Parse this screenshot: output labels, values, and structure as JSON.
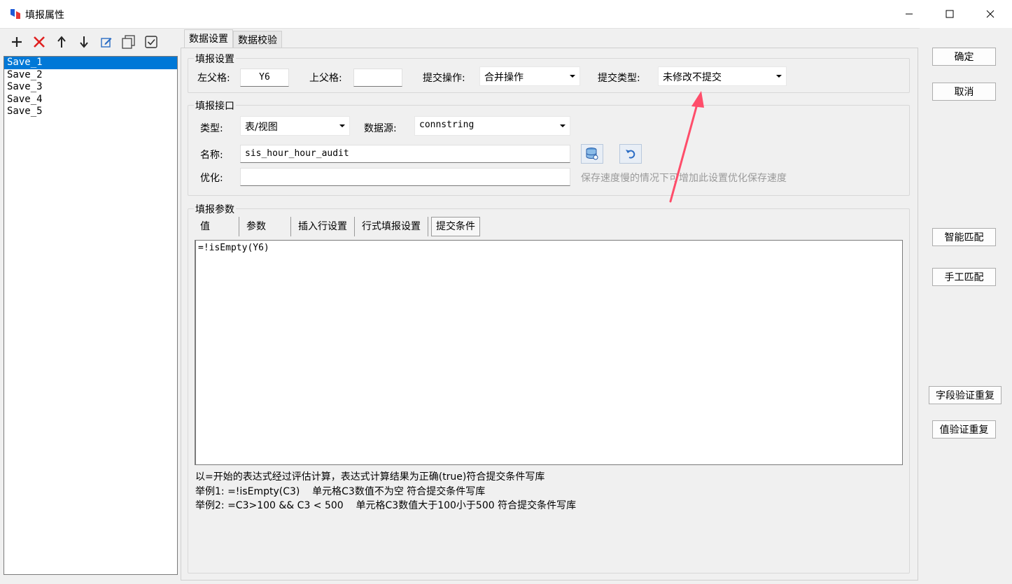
{
  "window": {
    "title": "填报属性",
    "minimize_icon": "minimize-icon",
    "maximize_icon": "maximize-icon",
    "close_icon": "close-icon"
  },
  "left_toolbar": {
    "icons": [
      "plus-icon",
      "delete-x-icon",
      "arrow-up-icon",
      "arrow-down-icon",
      "edit-icon",
      "copy-icon",
      "check-icon"
    ]
  },
  "save_list": {
    "items": [
      "Save_1",
      "Save_2",
      "Save_3",
      "Save_4",
      "Save_5"
    ],
    "selected": "Save_1"
  },
  "tabs": [
    "数据设置",
    "数据校验"
  ],
  "fill_settings": {
    "title": "填报设置",
    "left_parent_label": "左父格:",
    "left_parent_value": "Y6",
    "top_parent_label": "上父格:",
    "top_parent_value": "",
    "submit_op_label": "提交操作:",
    "submit_op_value": "合并操作",
    "submit_type_label": "提交类型:",
    "submit_type_value": "未修改不提交"
  },
  "fill_interface": {
    "title": "填报接口",
    "type_label": "类型:",
    "type_value": "表/视图",
    "datasource_label": "数据源:",
    "datasource_value": "connstring",
    "name_label": "名称:",
    "name_value": "sis_hour_hour_audit",
    "optimize_label": "优化:",
    "optimize_value": "",
    "optimize_hint": "保存速度慢的情况下可增加此设置优化保存速度"
  },
  "fill_params": {
    "title": "填报参数",
    "subtabs": [
      "值",
      "参数",
      "插入行设置",
      "行式填报设置",
      "提交条件"
    ],
    "active_subtab": "提交条件",
    "expression": "=!isEmpty(Y6)",
    "help": [
      "以=开始的表达式经过评估计算，表达式计算结果为正确(true)符合提交条件写库",
      "举例1: =!isEmpty(C3)    单元格C3数值不为空 符合提交条件写库",
      "举例2: =C3>100 && C3 < 500    单元格C3数值大于100小于500 符合提交条件写库"
    ]
  },
  "right_buttons": {
    "ok": "确定",
    "cancel": "取消",
    "smart_match": "智能匹配",
    "manual_match": "手工匹配",
    "field_dup": "字段验证重复",
    "value_dup": "值验证重复"
  },
  "colors": {
    "selection": "#0078d7",
    "annotation_arrow": "#ff4d6a"
  }
}
